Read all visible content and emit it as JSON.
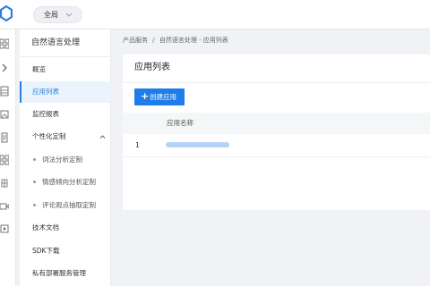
{
  "topbar": {
    "logo_icon": "hexagon-logo-icon",
    "region_selector": {
      "value": "全局",
      "chevron_icon": "chevron-down-icon"
    }
  },
  "rail_icons": [
    "grid-icon",
    "chevron-right-icon",
    "database-icon",
    "image-icon",
    "document-icon",
    "apps-icon",
    "nodes-icon",
    "video-icon",
    "play-icon"
  ],
  "sidebar": {
    "title": "自然语言处理",
    "items": [
      {
        "label": "概览",
        "active": false
      },
      {
        "label": "应用列表",
        "active": true
      },
      {
        "label": "监控报表",
        "active": false
      },
      {
        "label": "个性化定制",
        "expanded": true,
        "children": [
          "词法分析定制",
          "情感倾向分析定制",
          "评论观点抽取定制"
        ]
      },
      {
        "label": "技术文档",
        "active": false
      },
      {
        "label": "SDK下载",
        "active": false
      },
      {
        "label": "私有部署服务管理",
        "active": false
      }
    ]
  },
  "breadcrumb": [
    "产品服务",
    "/",
    "自然语言处理 - 应用列表"
  ],
  "panel": {
    "title": "应用列表",
    "create_button": {
      "icon": "plus-icon",
      "label": "创建应用"
    },
    "table": {
      "columns": [
        "",
        "应用名称"
      ],
      "rows": [
        {
          "index": "1",
          "name": ""
        }
      ]
    }
  },
  "colors": {
    "accent": "#1f7ce8",
    "active_bg": "#ebf3fd",
    "content_bg": "#f0f2f5"
  }
}
